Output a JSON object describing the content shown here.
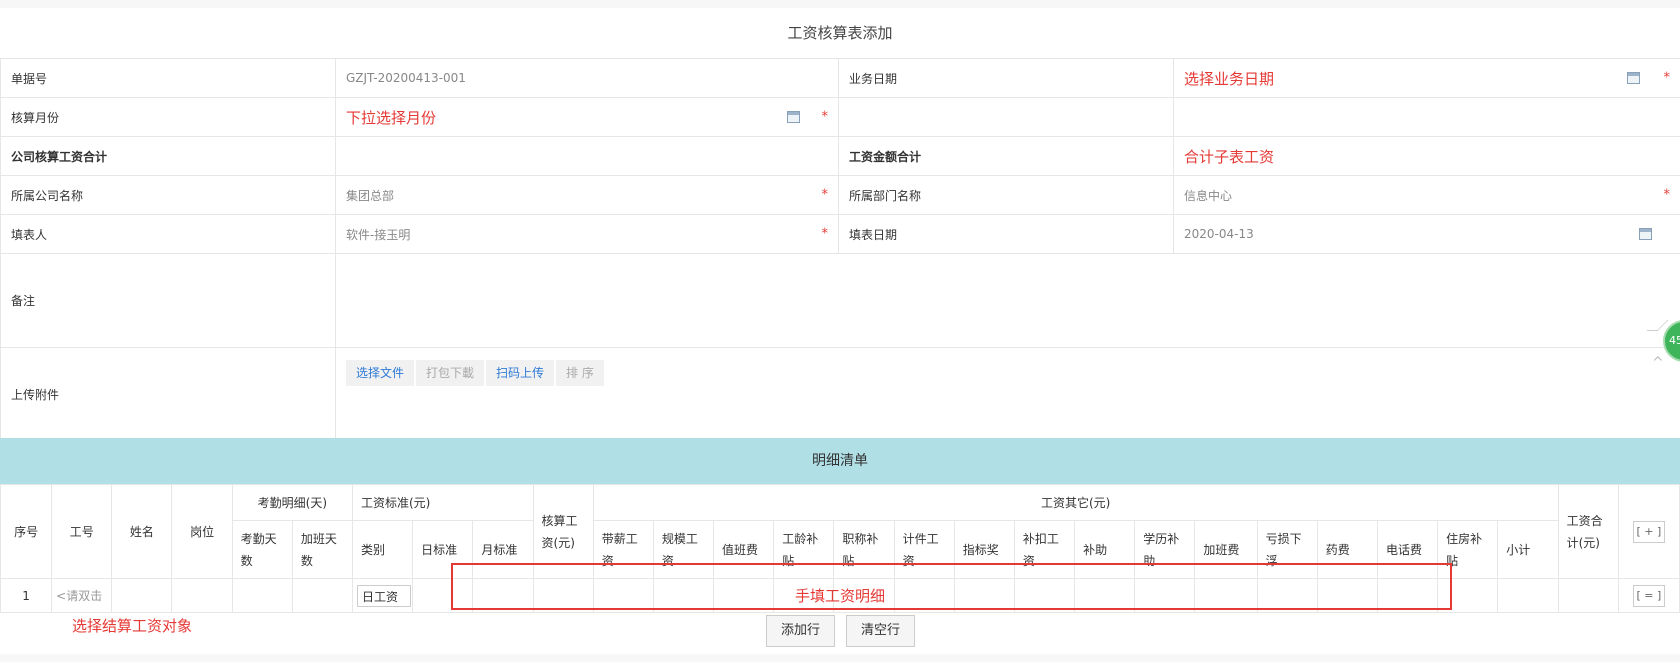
{
  "page_title": "工资核算表添加",
  "form": {
    "doc_no_label": "单据号",
    "doc_no_value": "GZJT-20200413-001",
    "biz_date_label": "业务日期",
    "biz_date_annot": "选择业务日期",
    "month_label": "核算月份",
    "month_annot": "下拉选择月份",
    "company_total_label": "公司核算工资合计",
    "salary_total_label": "工资金额合计",
    "salary_total_annot": "合计子表工资",
    "company_label": "所属公司名称",
    "company_value": "集团总部",
    "dept_label": "所属部门名称",
    "dept_value": "信息中心",
    "filler_label": "填表人",
    "filler_value": "软件-接玉明",
    "fill_date_label": "填表日期",
    "fill_date_value": "2020-04-13",
    "remark_label": "备注",
    "attach_label": "上传附件",
    "attach_buttons": [
      "选择文件",
      "打包下載",
      "扫码上传",
      "排 序"
    ],
    "required_mark": "*"
  },
  "detail": {
    "title": "明细清单",
    "groups": {
      "attendance": "考勤明细(天)",
      "standard": "工资标准(元)",
      "other": "工资其它(元)"
    },
    "cols": {
      "seq": "序号",
      "emp_no": "工号",
      "name": "姓名",
      "position": "岗位",
      "attend_days": "考勤天数",
      "ot_days": "加班天数",
      "category": "类别",
      "day_std": "日标准",
      "month_std": "月标准",
      "calc_salary": "核算工资(元)",
      "total_salary": "工资合计(元)",
      "other": [
        "带薪工资",
        "规模工资",
        "值班费",
        "工龄补贴",
        "职称补贴",
        "计件工资",
        "指标奖",
        "补扣工资",
        "补助",
        "学历补助",
        "加班费",
        "亏损下浮",
        "药费",
        "电话费",
        "住房补贴",
        "小计"
      ]
    },
    "add_col_button": "[ + ]",
    "row": {
      "seq": "1",
      "emp_placeholder": "<请双击",
      "category": "日工资",
      "row_menu": "[ = ]"
    },
    "handfill_annot": "手填工资明细",
    "select_object_annot": "选择结算工资对象",
    "add_row_button": "添加行",
    "clear_row_button": "清空行"
  },
  "side_badge": "45"
}
